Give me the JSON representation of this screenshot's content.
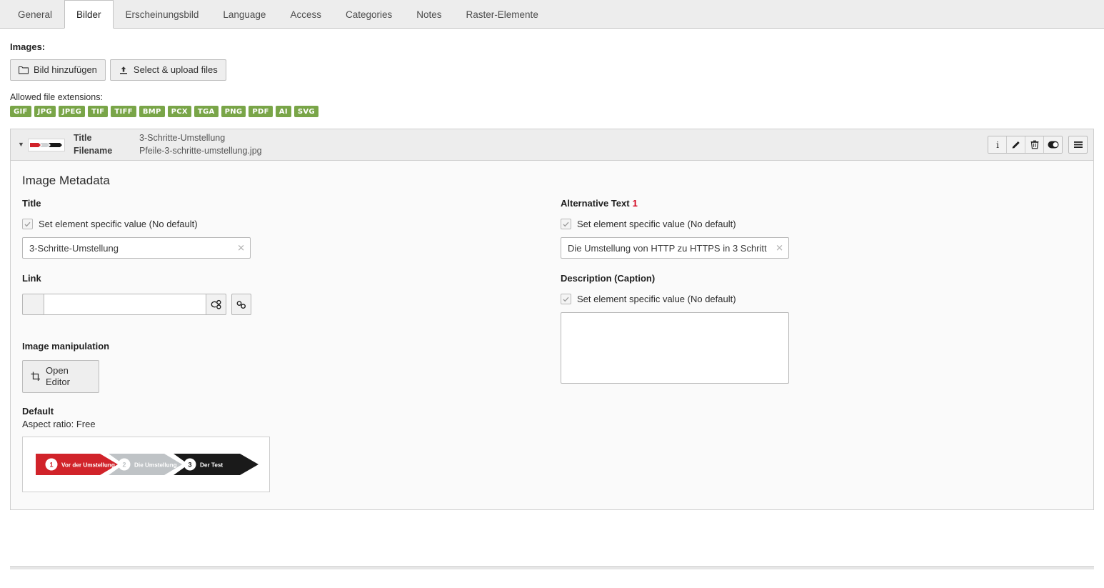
{
  "tabs": [
    {
      "label": "General",
      "active": false
    },
    {
      "label": "Bilder",
      "active": true
    },
    {
      "label": "Erscheinungsbild",
      "active": false
    },
    {
      "label": "Language",
      "active": false
    },
    {
      "label": "Access",
      "active": false
    },
    {
      "label": "Categories",
      "active": false
    },
    {
      "label": "Notes",
      "active": false
    },
    {
      "label": "Raster-Elemente",
      "active": false
    }
  ],
  "images_section": {
    "heading": "Images:",
    "add_image_button": "Bild hinzufügen",
    "upload_button": "Select & upload files",
    "allowed_label": "Allowed file extensions:",
    "extensions": [
      "GIF",
      "JPG",
      "JPEG",
      "TIF",
      "TIFF",
      "BMP",
      "PCX",
      "TGA",
      "PNG",
      "PDF",
      "AI",
      "SVG"
    ],
    "extension_color": "#79a548"
  },
  "record": {
    "title_key": "Title",
    "title_value": "3-Schritte-Umstellung",
    "filename_key": "Filename",
    "filename_value": "Pfeile-3-schritte-umstellung.jpg",
    "actions": [
      "info-icon",
      "edit-icon",
      "delete-icon",
      "toggle-icon",
      "drag-handle-icon"
    ]
  },
  "metadata": {
    "heading": "Image Metadata",
    "title": {
      "label": "Title",
      "checkbox_label": "Set element specific value (No default)",
      "checked": true,
      "value": "3-Schritte-Umstellung"
    },
    "alt_text": {
      "label": "Alternative Text",
      "badge": "1",
      "badge_color": "#d1021c",
      "checkbox_label": "Set element specific value (No default)",
      "checked": true,
      "value": "Die Umstellung von HTTP zu HTTPS in 3 Schritt"
    },
    "link": {
      "label": "Link",
      "value": "",
      "browse_icon": "link-browser-icon",
      "chain_icon": "chain-link-icon"
    },
    "description": {
      "label": "Description (Caption)",
      "checkbox_label": "Set element specific value (No default)",
      "checked": true,
      "value": ""
    }
  },
  "manipulation": {
    "heading": "Image manipulation",
    "open_editor_button": "Open Editor",
    "default_label": "Default",
    "aspect_ratio": "Aspect ratio: Free"
  },
  "preview_image": {
    "steps": [
      {
        "number": "1",
        "label": "Vor der Umstellung",
        "color": "#d1232a"
      },
      {
        "number": "2",
        "label": "Die Umstellung",
        "color": "#bfc3c6"
      },
      {
        "number": "3",
        "label": "Der Test",
        "color": "#1a1a1a"
      }
    ]
  }
}
